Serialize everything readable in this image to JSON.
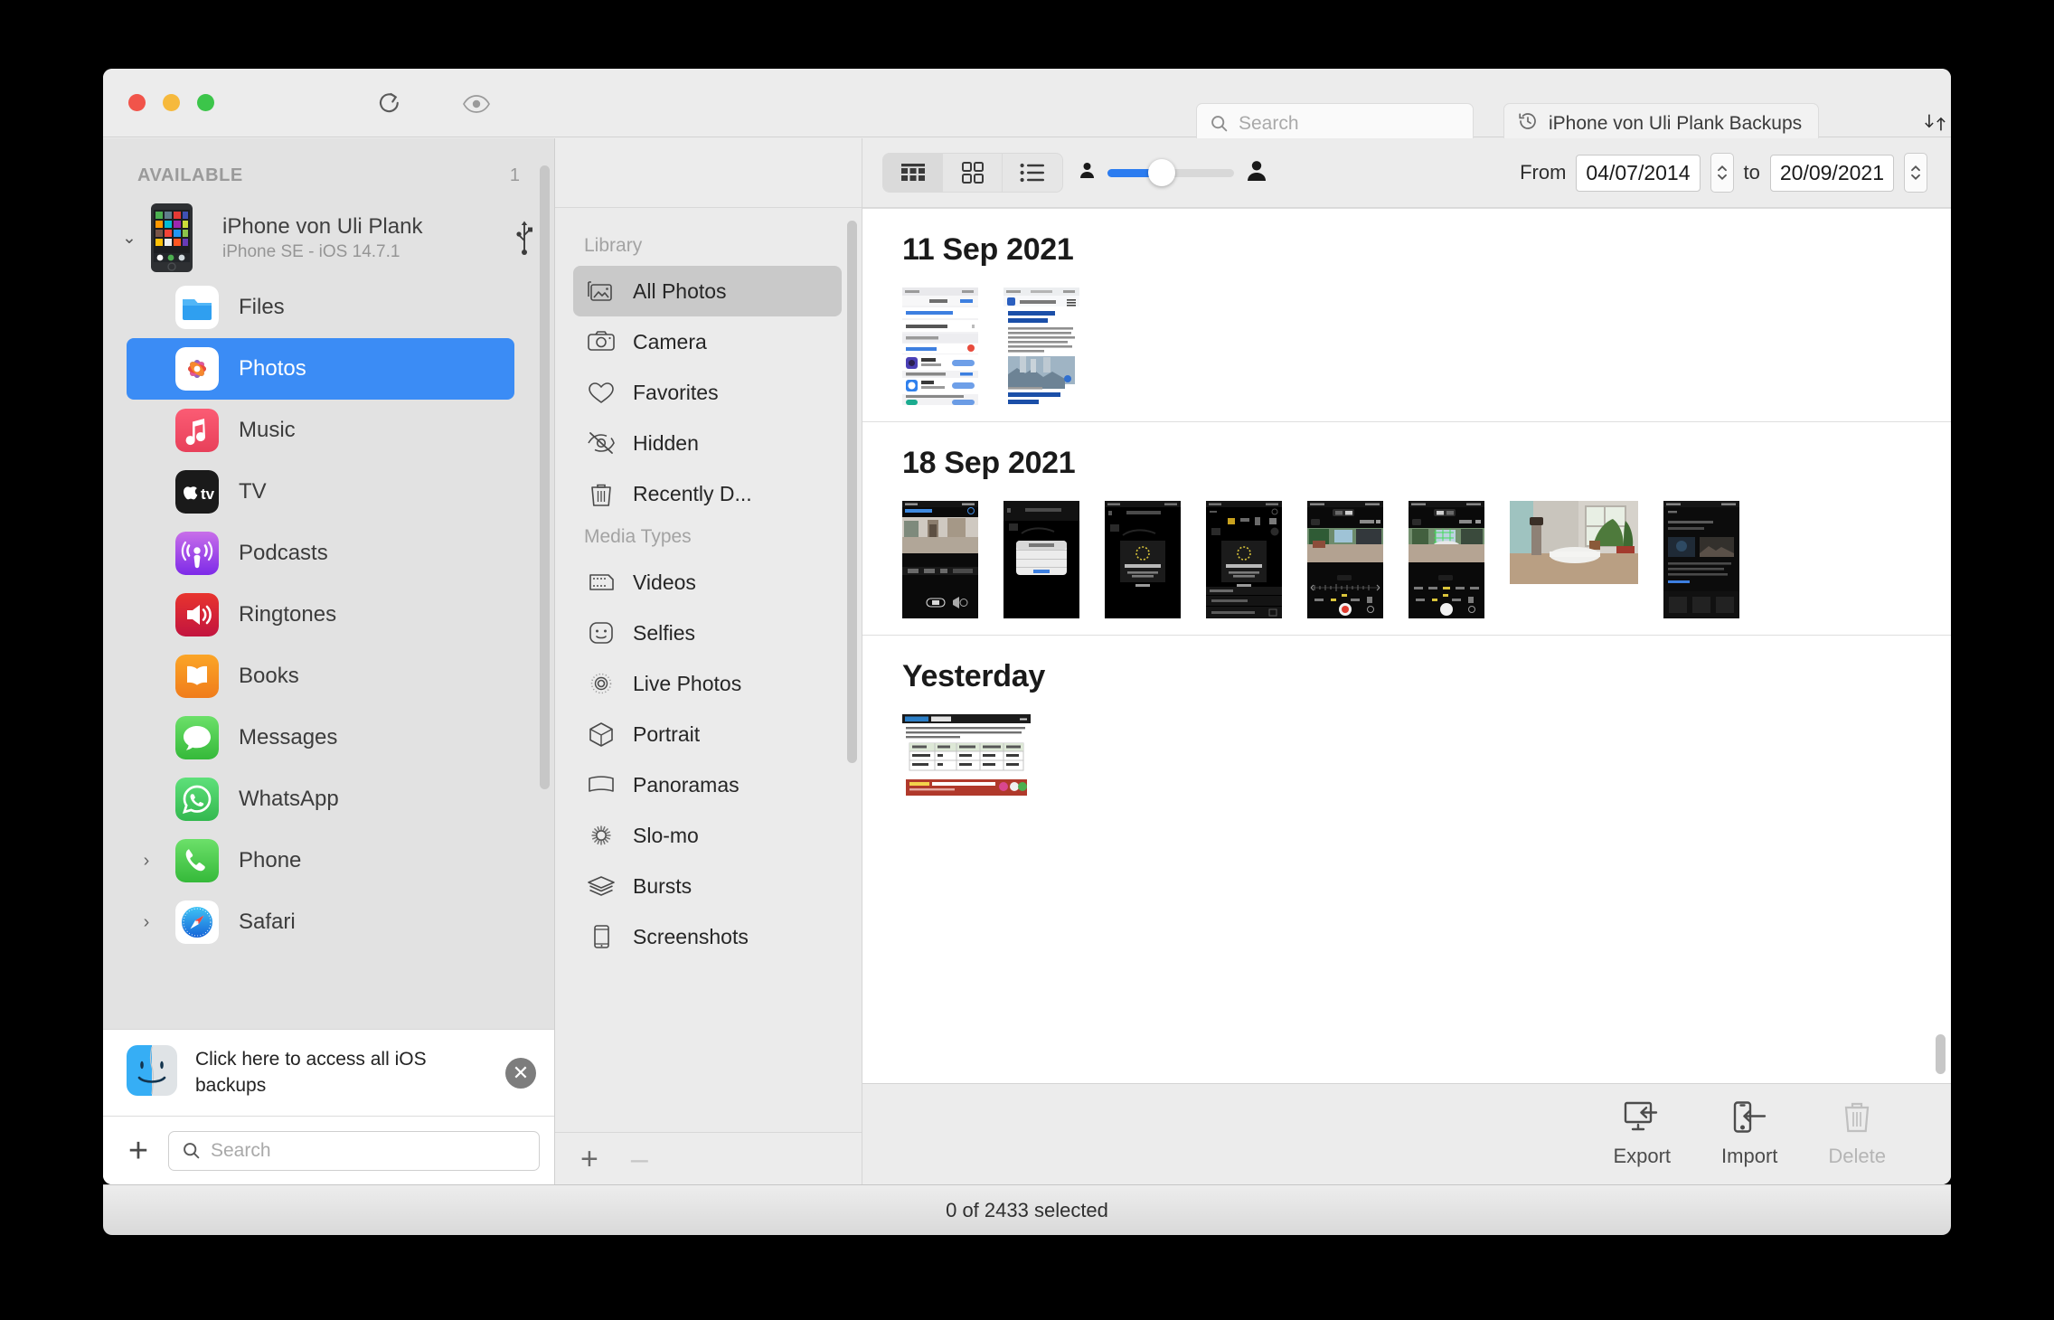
{
  "titlebar": {
    "refresh_icon": "refresh-icon",
    "eye_icon": "eye-icon",
    "search_placeholder": "Search",
    "backup_button_label": "iPhone von Uli Plank Backups",
    "backup_icon": "history-clock-icon",
    "sort_icon": "sort-arrows-icon",
    "help_label": "?"
  },
  "sidebar": {
    "section_label": "AVAILABLE",
    "section_count": "1",
    "device": {
      "name": "iPhone von Uli Plank",
      "subtitle": "iPhone SE - iOS 14.7.1",
      "disclosure_icon": "chevron-down-icon",
      "connection_icon": "usb-icon"
    },
    "items": [
      {
        "label": "Files",
        "icon": "files-icon",
        "selected": false,
        "disclosure": false
      },
      {
        "label": "Photos",
        "icon": "photos-icon",
        "selected": true,
        "disclosure": false
      },
      {
        "label": "Music",
        "icon": "music-icon",
        "selected": false,
        "disclosure": false
      },
      {
        "label": "TV",
        "icon": "appletv-icon",
        "selected": false,
        "disclosure": false
      },
      {
        "label": "Podcasts",
        "icon": "podcasts-icon",
        "selected": false,
        "disclosure": false
      },
      {
        "label": "Ringtones",
        "icon": "ringtones-icon",
        "selected": false,
        "disclosure": false
      },
      {
        "label": "Books",
        "icon": "books-icon",
        "selected": false,
        "disclosure": false
      },
      {
        "label": "Messages",
        "icon": "messages-icon",
        "selected": false,
        "disclosure": false
      },
      {
        "label": "WhatsApp",
        "icon": "whatsapp-icon",
        "selected": false,
        "disclosure": false
      },
      {
        "label": "Phone",
        "icon": "phone-icon",
        "selected": false,
        "disclosure": true
      },
      {
        "label": "Safari",
        "icon": "safari-icon",
        "selected": false,
        "disclosure": true
      }
    ],
    "banner": {
      "text": "Click here to access all iOS backups",
      "icon": "finder-icon",
      "close_icon": "close-circle-icon"
    },
    "add_label": "+",
    "search_placeholder": "Search"
  },
  "midpanel": {
    "groups": [
      {
        "label": "Library",
        "items": [
          {
            "label": "All Photos",
            "icon": "photo-frame-icon",
            "selected": true
          },
          {
            "label": "Camera",
            "icon": "camera-icon",
            "selected": false
          },
          {
            "label": "Favorites",
            "icon": "heart-icon",
            "selected": false
          },
          {
            "label": "Hidden",
            "icon": "eye-slash-icon",
            "selected": false
          },
          {
            "label": "Recently D...",
            "icon": "trash-icon",
            "selected": false
          }
        ]
      },
      {
        "label": "Media Types",
        "items": [
          {
            "label": "Videos",
            "icon": "film-icon",
            "selected": false
          },
          {
            "label": "Selfies",
            "icon": "face-icon",
            "selected": false
          },
          {
            "label": "Live Photos",
            "icon": "live-photo-icon",
            "selected": false
          },
          {
            "label": "Portrait",
            "icon": "cube-icon",
            "selected": false
          },
          {
            "label": "Panoramas",
            "icon": "panorama-icon",
            "selected": false
          },
          {
            "label": "Slo-mo",
            "icon": "slomo-icon",
            "selected": false
          },
          {
            "label": "Bursts",
            "icon": "layers-icon",
            "selected": false
          },
          {
            "label": "Screenshots",
            "icon": "phone-frame-icon",
            "selected": false
          }
        ]
      }
    ],
    "add_label": "+",
    "remove_label": "–"
  },
  "content_toolbar": {
    "view_modes": [
      {
        "name": "grid-dense-view",
        "selected": true
      },
      {
        "name": "grid-large-view",
        "selected": false
      },
      {
        "name": "list-view",
        "selected": false
      }
    ],
    "zoom_small_icon": "person-small-icon",
    "zoom_large_icon": "person-large-icon",
    "zoom_value": 32,
    "date_from_label": "From",
    "date_from_value": "04/07/2014",
    "date_to_label": "to",
    "date_to_value": "20/09/2021"
  },
  "photo_sections": [
    {
      "title": "11 Sep 2021",
      "thumbs": [
        {
          "kind": "ios-settings-screenshot",
          "orientation": "portrait"
        },
        {
          "kind": "news-article-screenshot",
          "orientation": "portrait"
        }
      ]
    },
    {
      "title": "18 Sep 2021",
      "thumbs": [
        {
          "kind": "camera-preview-screenshot",
          "orientation": "portrait"
        },
        {
          "kind": "dialog-dark-screenshot",
          "orientation": "portrait"
        },
        {
          "kind": "loading-dark-screenshot",
          "orientation": "portrait"
        },
        {
          "kind": "loading-dark-screenshot-2",
          "orientation": "portrait"
        },
        {
          "kind": "camera-video-screenshot",
          "orientation": "portrait"
        },
        {
          "kind": "camera-grid-screenshot",
          "orientation": "portrait"
        },
        {
          "kind": "room-photo",
          "orientation": "landscape"
        },
        {
          "kind": "dark-app-screenshot",
          "orientation": "portrait"
        }
      ]
    },
    {
      "title": "Yesterday",
      "thumbs": [
        {
          "kind": "web-comparison-screenshot",
          "orientation": "landscape"
        }
      ]
    }
  ],
  "actionbar": {
    "export_label": "Export",
    "export_icon": "export-monitor-icon",
    "import_label": "Import",
    "import_icon": "import-phone-icon",
    "delete_label": "Delete",
    "delete_icon": "trash-icon",
    "delete_disabled": true
  },
  "statusbar": {
    "text": "0 of 2433 selected"
  },
  "colors": {
    "accent_blue": "#3b8cf5",
    "slider_blue": "#2b7cf0",
    "window_chrome": "#ececec",
    "sidebar_bg": "#e2e2e2"
  }
}
